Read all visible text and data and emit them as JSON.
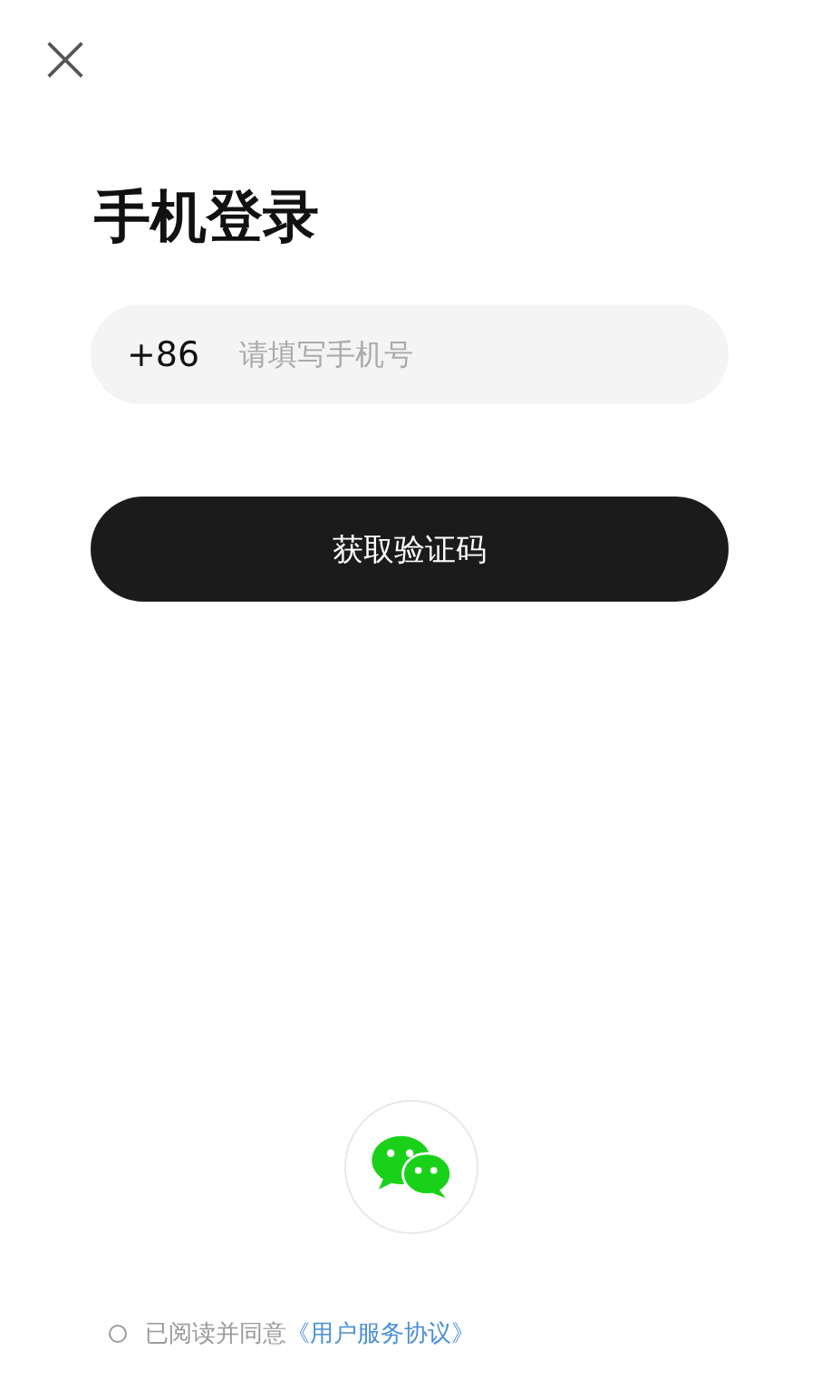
{
  "title": "手机登录",
  "phone_field": {
    "country_code": "+86",
    "placeholder": "请填写手机号"
  },
  "submit_button": {
    "label": "获取验证码"
  },
  "third_party_login": [
    {
      "kind": "wechat"
    }
  ],
  "agreement": {
    "checked": false,
    "text": "已阅读并同意",
    "link": "《用户服务协议》"
  }
}
